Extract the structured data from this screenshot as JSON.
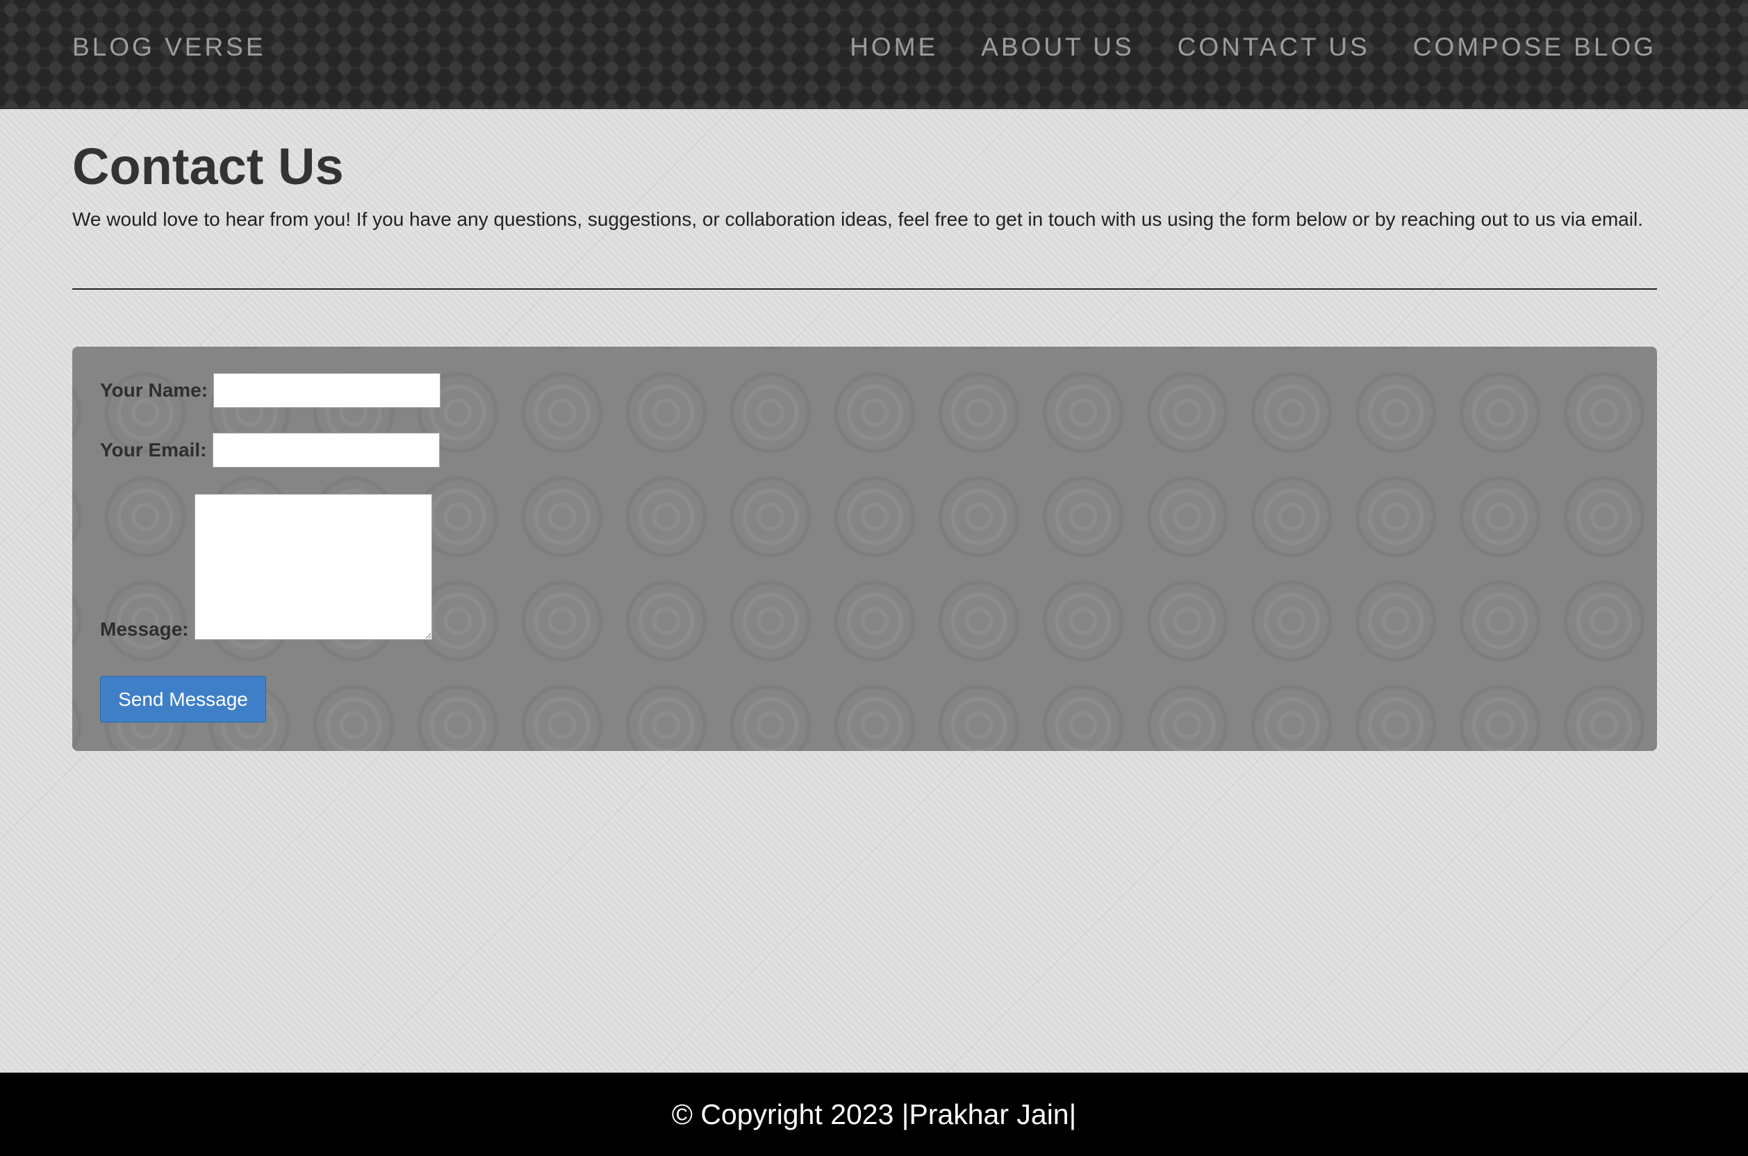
{
  "header": {
    "brand": "BLOG VERSE",
    "nav": [
      {
        "label": "HOME"
      },
      {
        "label": "ABOUT US"
      },
      {
        "label": "CONTACT US"
      },
      {
        "label": "COMPOSE BLOG"
      }
    ]
  },
  "main": {
    "title": "Contact Us",
    "intro": "We would love to hear from you! If you have any questions, suggestions, or collaboration ideas, feel free to get in touch with us using the form below or by reaching out to us via email."
  },
  "form": {
    "name_label": "Your Name:",
    "name_value": "",
    "email_label": "Your Email:",
    "email_value": "",
    "message_label": "Message:",
    "message_value": "",
    "submit_label": "Send Message"
  },
  "footer": {
    "text": "© Copyright 2023 |Prakhar Jain|"
  },
  "colors": {
    "navbar": "#2f2f2f",
    "nav_text": "#9d9d9d",
    "form_card": "#858585",
    "button": "#3f7fc7",
    "footer": "#000000"
  }
}
